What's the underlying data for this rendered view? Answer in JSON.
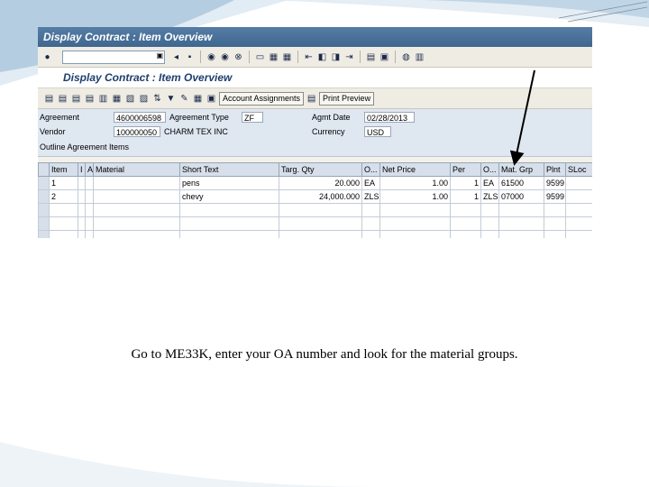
{
  "window": {
    "title": "Display Contract : Item Overview"
  },
  "screen": {
    "title": "Display Contract : Item Overview"
  },
  "toolbar": {
    "command_field_value": ""
  },
  "app_toolbar": {
    "account_assignments_label": "Account Assignments",
    "print_preview_label": "Print Preview"
  },
  "header": {
    "agreement_label": "Agreement",
    "agreement_value": "4600006598",
    "agreement_type_label": "Agreement Type",
    "agreement_type_value": "ZF",
    "agmt_date_label": "Agmt Date",
    "agmt_date_value": "02/28/2013",
    "vendor_label": "Vendor",
    "vendor_value": "100000050",
    "vendor_name": "CHARM TEX INC",
    "currency_label": "Currency",
    "currency_value": "USD",
    "section_label": "Outline Agreement Items"
  },
  "table": {
    "columns": [
      "Item",
      "I",
      "A",
      "Material",
      "Short Text",
      "Targ. Qty",
      "O...",
      "Net Price",
      "Per",
      "O...",
      "Mat. Grp",
      "Plnt",
      "SLoc"
    ],
    "rows": [
      {
        "item": "1",
        "i": "",
        "a": "",
        "material": "",
        "short_text": "pens",
        "targ_qty": "20.000",
        "oun": "EA",
        "net_price": "1.00",
        "per": "1",
        "opu": "EA",
        "mat_grp": "61500",
        "plnt": "9599",
        "sloc": ""
      },
      {
        "item": "2",
        "i": "",
        "a": "",
        "material": "",
        "short_text": "chevy",
        "targ_qty": "24,000.000",
        "oun": "ZLS",
        "net_price": "1.00",
        "per": "1",
        "opu": "ZLS",
        "mat_grp": "07000",
        "plnt": "9599",
        "sloc": ""
      }
    ]
  },
  "caption": "Go to ME33K, enter your OA number and look for the material groups.",
  "colors": {
    "sap_titlebar": "#4a7299",
    "grid_header": "#d6dfea",
    "header_panel": "#dfe7f1",
    "slide_accent": "#8fb4cf"
  }
}
